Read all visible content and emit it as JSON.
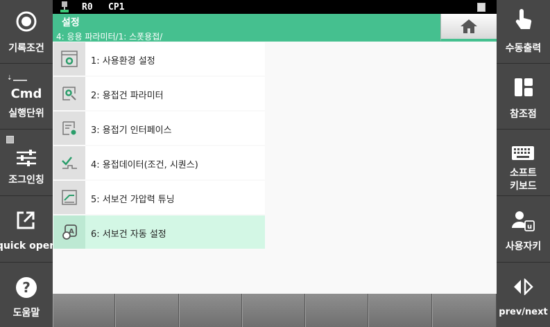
{
  "statusbar": {
    "robot": "R0",
    "cp": "CP1"
  },
  "header": {
    "title": "설정",
    "breadcrumb": "4: 응용 파라미터/1: 스폿용접/"
  },
  "menu": [
    {
      "label": "1: 사용환경 설정",
      "icon": "env-settings-icon"
    },
    {
      "label": "2: 용접건 파라미터",
      "icon": "gun-param-icon"
    },
    {
      "label": "3: 용접기 인터페이스",
      "icon": "welder-interface-icon"
    },
    {
      "label": "4: 용접데이터(조건, 시퀀스)",
      "icon": "weld-data-icon"
    },
    {
      "label": "5: 서보건 가압력 튜닝",
      "icon": "servo-pressure-icon"
    },
    {
      "label": "6: 서보건 자동 설정",
      "icon": "servo-auto-icon",
      "selected": true
    }
  ],
  "left_panel": {
    "record_label": "기록조건",
    "cmd_label": "Cmd",
    "exec_label": "실행단위",
    "jog_label": "조그인칭",
    "quick_label": "quick open",
    "help_label": "도움말"
  },
  "right_panel": {
    "manual_label": "수동출력",
    "ref_label": "참조점",
    "soft_label_1": "소프트",
    "soft_label_2": "키보드",
    "user_label": "사용자키",
    "prevnext_label": "prev/next"
  },
  "colors": {
    "accent": "#45c08f",
    "selected": "#d3f7e5",
    "panel": "#474747"
  }
}
